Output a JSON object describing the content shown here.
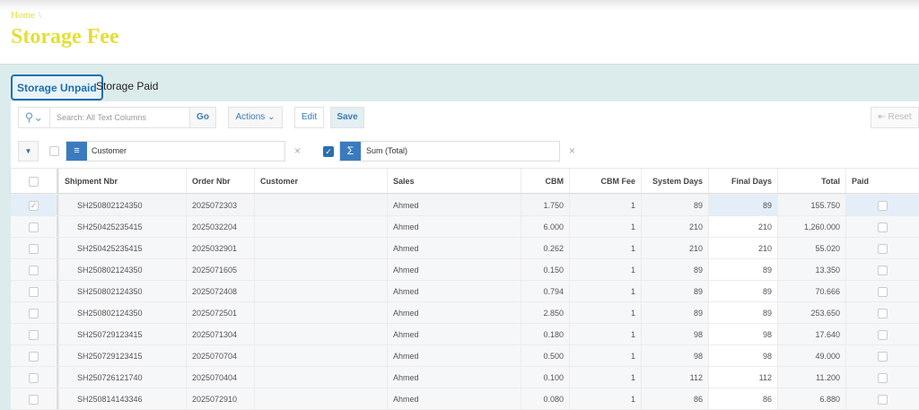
{
  "breadcrumb": {
    "home": "Home",
    "sep": "\\"
  },
  "page_title": "Storage Fee",
  "tabs": [
    {
      "label": "Storage Unpaid"
    },
    {
      "label": "Storage Paid"
    }
  ],
  "toolbar": {
    "search_placeholder": "Search: All Text Columns",
    "go": "Go",
    "actions": "Actions ⌄",
    "edit": "Edit",
    "save": "Save",
    "reset": "Reset"
  },
  "filters": {
    "control_break": "Customer",
    "aggregate": "Sum (Total)"
  },
  "columns": [
    "Shipment Nbr",
    "Order Nbr",
    "Customer",
    "Sales",
    "CBM",
    "CBM Fee",
    "System Days",
    "Final Days",
    "Total",
    "Paid"
  ],
  "rows": [
    [
      "SH250802124350",
      "2025072303",
      "",
      "Ahmed",
      "1.750",
      "1",
      "89",
      "89",
      "155.750"
    ],
    [
      "SH250425235415",
      "2025032204",
      "",
      "Ahmed",
      "6.000",
      "1",
      "210",
      "210",
      "1,260.000"
    ],
    [
      "SH250425235415",
      "2025032901",
      "",
      "Ahmed",
      "0.262",
      "1",
      "210",
      "210",
      "55.020"
    ],
    [
      "SH250802124350",
      "2025071605",
      "",
      "Ahmed",
      "0.150",
      "1",
      "89",
      "89",
      "13.350"
    ],
    [
      "SH250802124350",
      "2025072408",
      "",
      "Ahmed",
      "0.794",
      "1",
      "89",
      "89",
      "70.666"
    ],
    [
      "SH250802124350",
      "2025072501",
      "",
      "Ahmed",
      "2.850",
      "1",
      "89",
      "89",
      "253.650"
    ],
    [
      "SH250729123415",
      "2025071304",
      "",
      "Ahmed",
      "0.180",
      "1",
      "98",
      "98",
      "17.640"
    ],
    [
      "SH250729123415",
      "2025070704",
      "",
      "Ahmed",
      "0.500",
      "1",
      "98",
      "98",
      "49.000"
    ],
    [
      "SH250726121740",
      "2025070404",
      "",
      "Ahmed",
      "0.100",
      "1",
      "112",
      "112",
      "11.200"
    ],
    [
      "SH250814143346",
      "2025072910",
      "",
      "Ahmed",
      "0.080",
      "1",
      "86",
      "86",
      "6.880"
    ]
  ]
}
